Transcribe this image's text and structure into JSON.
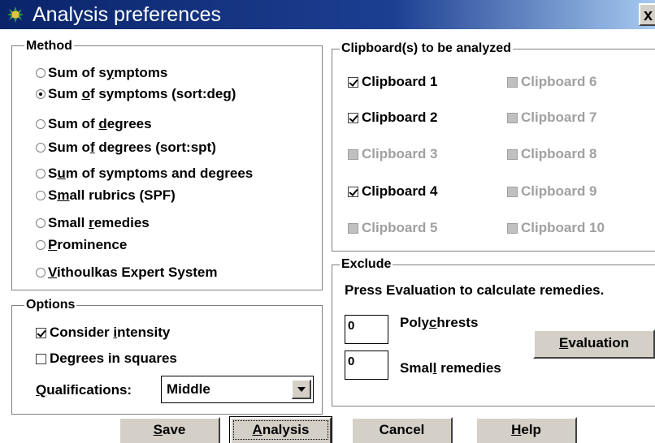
{
  "window": {
    "title": "Analysis preferences",
    "close_label": "x"
  },
  "method": {
    "legend": "Method",
    "options": [
      {
        "label_pre": "Sum of s",
        "mnemonic": "y",
        "label_post": "mptoms",
        "selected": false
      },
      {
        "label_pre": "Sum ",
        "mnemonic": "o",
        "label_post": "f symptoms (sort:deg)",
        "selected": true
      },
      {
        "label_pre": "Sum of ",
        "mnemonic": "d",
        "label_post": "egrees",
        "selected": false
      },
      {
        "label_pre": "Sum o",
        "mnemonic": "f",
        "label_post": " degrees (sort:spt)",
        "selected": false
      },
      {
        "label_pre": "S",
        "mnemonic": "u",
        "label_post": "m of symptoms and degrees",
        "selected": false
      },
      {
        "label_pre": "S",
        "mnemonic": "m",
        "label_post": "all rubrics (SPF)",
        "selected": false
      },
      {
        "label_pre": "Small ",
        "mnemonic": "r",
        "label_post": "emedies",
        "selected": false
      },
      {
        "label_pre": "",
        "mnemonic": "P",
        "label_post": "rominence",
        "selected": false
      },
      {
        "label_pre": "",
        "mnemonic": "V",
        "label_post": "ithoulkas Expert System",
        "selected": false
      }
    ]
  },
  "options": {
    "legend": "Options",
    "consider_intensity": {
      "label_pre": "Consider ",
      "mnemonic": "i",
      "label_post": "ntensity",
      "checked": true
    },
    "degrees_in_squares": {
      "label": "Degrees in squares",
      "checked": false
    },
    "qualifications_label_pre": "",
    "qualifications_mnemonic": "Q",
    "qualifications_label_post": "ualifications:",
    "qualifications_value": "Middle"
  },
  "clipboards": {
    "legend": "Clipboard(s) to be analyzed",
    "items": [
      {
        "label": "Clipboard 1",
        "checked": true,
        "enabled": true
      },
      {
        "label": "Clipboard 2",
        "checked": true,
        "enabled": true
      },
      {
        "label": "Clipboard 3",
        "checked": false,
        "enabled": false
      },
      {
        "label": "Clipboard 4",
        "checked": true,
        "enabled": true
      },
      {
        "label": "Clipboard 5",
        "checked": false,
        "enabled": false
      },
      {
        "label": "Clipboard 6",
        "checked": false,
        "enabled": false
      },
      {
        "label": "Clipboard 7",
        "checked": false,
        "enabled": false
      },
      {
        "label": "Clipboard 8",
        "checked": false,
        "enabled": false
      },
      {
        "label": "Clipboard 9",
        "checked": false,
        "enabled": false
      },
      {
        "label": "Clipboard 10",
        "checked": false,
        "enabled": false
      }
    ]
  },
  "exclude": {
    "legend": "Exclude",
    "instruction": "Press Evaluation to calculate remedies.",
    "polychrests_value": "0",
    "polychrests_label_pre": "Poly",
    "polychrests_mnemonic": "c",
    "polychrests_label_post": "hrests",
    "small_value": "0",
    "small_label_pre": "Smal",
    "small_mnemonic": "l",
    "small_label_post": " remedies",
    "evaluation_pre": "",
    "evaluation_mnemonic": "E",
    "evaluation_post": "valuation"
  },
  "buttons": {
    "save": {
      "pre": "",
      "mnemonic": "S",
      "post": "ave"
    },
    "analysis": {
      "pre": "",
      "mnemonic": "A",
      "post": "nalysis"
    },
    "cancel": {
      "label": "Cancel"
    },
    "help": {
      "pre": "",
      "mnemonic": "H",
      "post": "elp"
    }
  }
}
